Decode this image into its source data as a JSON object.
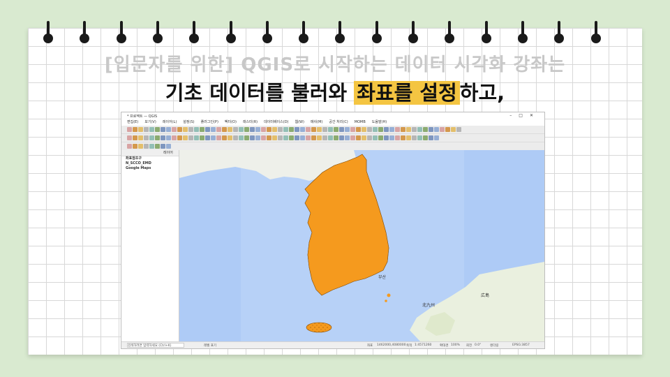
{
  "subtitle": "[입문자를 위한] QGIS로 시작하는 데이터 시각화 강좌는",
  "title": {
    "part1": "기초 데이터를 불러와 ",
    "highlight": "좌표를 설정",
    "part2": "하고,"
  },
  "colors": {
    "background": "#d9ead0",
    "highlight": "#f4c542",
    "land_fill": "#f59a1e",
    "water": "#aecbf6"
  },
  "pin_count": 16,
  "qgis": {
    "window_title": "* 프로젝트 — QGIS",
    "menu_items": [
      "편집(E)",
      "보기(V)",
      "레이어(L)",
      "설정(S)",
      "플러그인(P)",
      "벡터(O)",
      "래스터(R)",
      "데이터베이스(D)",
      "웹(W)",
      "메쉬(M)",
      "공간 처리(C)",
      "MOMB",
      "도움말(H)"
    ],
    "layers_panel": {
      "header": "레이어",
      "items": [
        "좌표참조구",
        "N_SCCO_EMD",
        "Google Maps"
      ]
    },
    "map_labels": {
      "busan": "부산",
      "hiroshima": "広島",
      "kitakyushu": "北九州"
    },
    "status": {
      "search_placeholder": "검색하려면 입력하세요 (Ctrl+K)",
      "messages": "레벨 표기",
      "coordinate_label": "좌표",
      "coordinate": "1462000,4080000",
      "scale_label": "축척",
      "scale": "1:4571260",
      "magnifier_label": "확대경",
      "magnifier": "100%",
      "rotation_label": "회전",
      "rotation": "0.0°",
      "render": "렌더링",
      "crs": "EPSG:3857"
    }
  }
}
